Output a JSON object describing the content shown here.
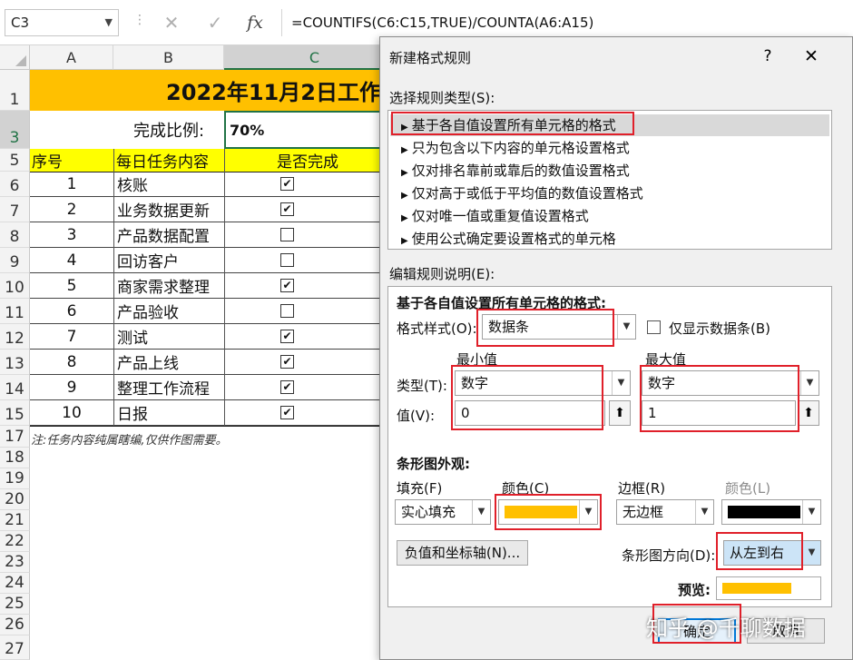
{
  "formula_bar": {
    "name_box": "C3",
    "cancel_icon": "✕",
    "enter_icon": "✓",
    "fx_label": "fx",
    "formula": "=COUNTIFS(C6:C15,TRUE)/COUNTA(A6:A15)"
  },
  "columns": [
    "A",
    "B",
    "C"
  ],
  "rows": [
    "1",
    "3",
    "5",
    "6",
    "7",
    "8",
    "9",
    "10",
    "11",
    "12",
    "13",
    "14",
    "15",
    "17",
    "18",
    "19",
    "20",
    "21",
    "22",
    "23",
    "24",
    "25",
    "26",
    "27"
  ],
  "sheet": {
    "title": "2022年11月2日工作",
    "ratio_label": "完成比例:",
    "ratio_value": "70%",
    "headers": [
      "序号",
      "每日任务内容",
      "是否完成"
    ],
    "tasks": [
      {
        "no": "1",
        "task": "核账",
        "done": true
      },
      {
        "no": "2",
        "task": "业务数据更新",
        "done": true
      },
      {
        "no": "3",
        "task": "产品数据配置",
        "done": false
      },
      {
        "no": "4",
        "task": "回访客户",
        "done": false
      },
      {
        "no": "5",
        "task": "商家需求整理",
        "done": true
      },
      {
        "no": "6",
        "task": "产品验收",
        "done": false
      },
      {
        "no": "7",
        "task": "测试",
        "done": true
      },
      {
        "no": "8",
        "task": "产品上线",
        "done": true
      },
      {
        "no": "9",
        "task": "整理工作流程",
        "done": true
      },
      {
        "no": "10",
        "task": "日报",
        "done": true
      }
    ],
    "note": "注:任务内容纯属瞎编,仅供作图需要。"
  },
  "dialog": {
    "title": "新建格式规则",
    "help": "?",
    "close": "✕",
    "select_rule_type_label": "选择规则类型(S):",
    "rule_types": [
      "基于各自值设置所有单元格的格式",
      "只为包含以下内容的单元格设置格式",
      "仅对排名靠前或靠后的数值设置格式",
      "仅对高于或低于平均值的数值设置格式",
      "仅对唯一值或重复值设置格式",
      "使用公式确定要设置格式的单元格"
    ],
    "edit_rule_label": "编辑规则说明(E):",
    "edit_heading": "基于各自值设置所有单元格的格式:",
    "format_style_label": "格式样式(O):",
    "format_style_value": "数据条",
    "show_bar_only_label": "仅显示数据条(B)",
    "min_label": "最小值",
    "max_label": "最大值",
    "type_label": "类型(T):",
    "value_label": "值(V):",
    "min_type": "数字",
    "max_type": "数字",
    "min_value": "0",
    "max_value": "1",
    "bar_appearance_label": "条形图外观:",
    "fill_label": "填充(F)",
    "color_label": "颜色(C)",
    "border_label": "边框(R)",
    "border_color_label": "颜色(L)",
    "fill_value": "实心填充",
    "border_value": "无边框",
    "neg_axis_button": "负值和坐标轴(N)...",
    "bar_direction_label": "条形图方向(D):",
    "bar_direction_value": "从左到右",
    "preview_label": "预览:",
    "ok_button": "确定",
    "cancel_button": "取消",
    "fill_color": "#FFC000",
    "border_color": "#000000"
  },
  "watermark": "知乎 @千聊数据"
}
